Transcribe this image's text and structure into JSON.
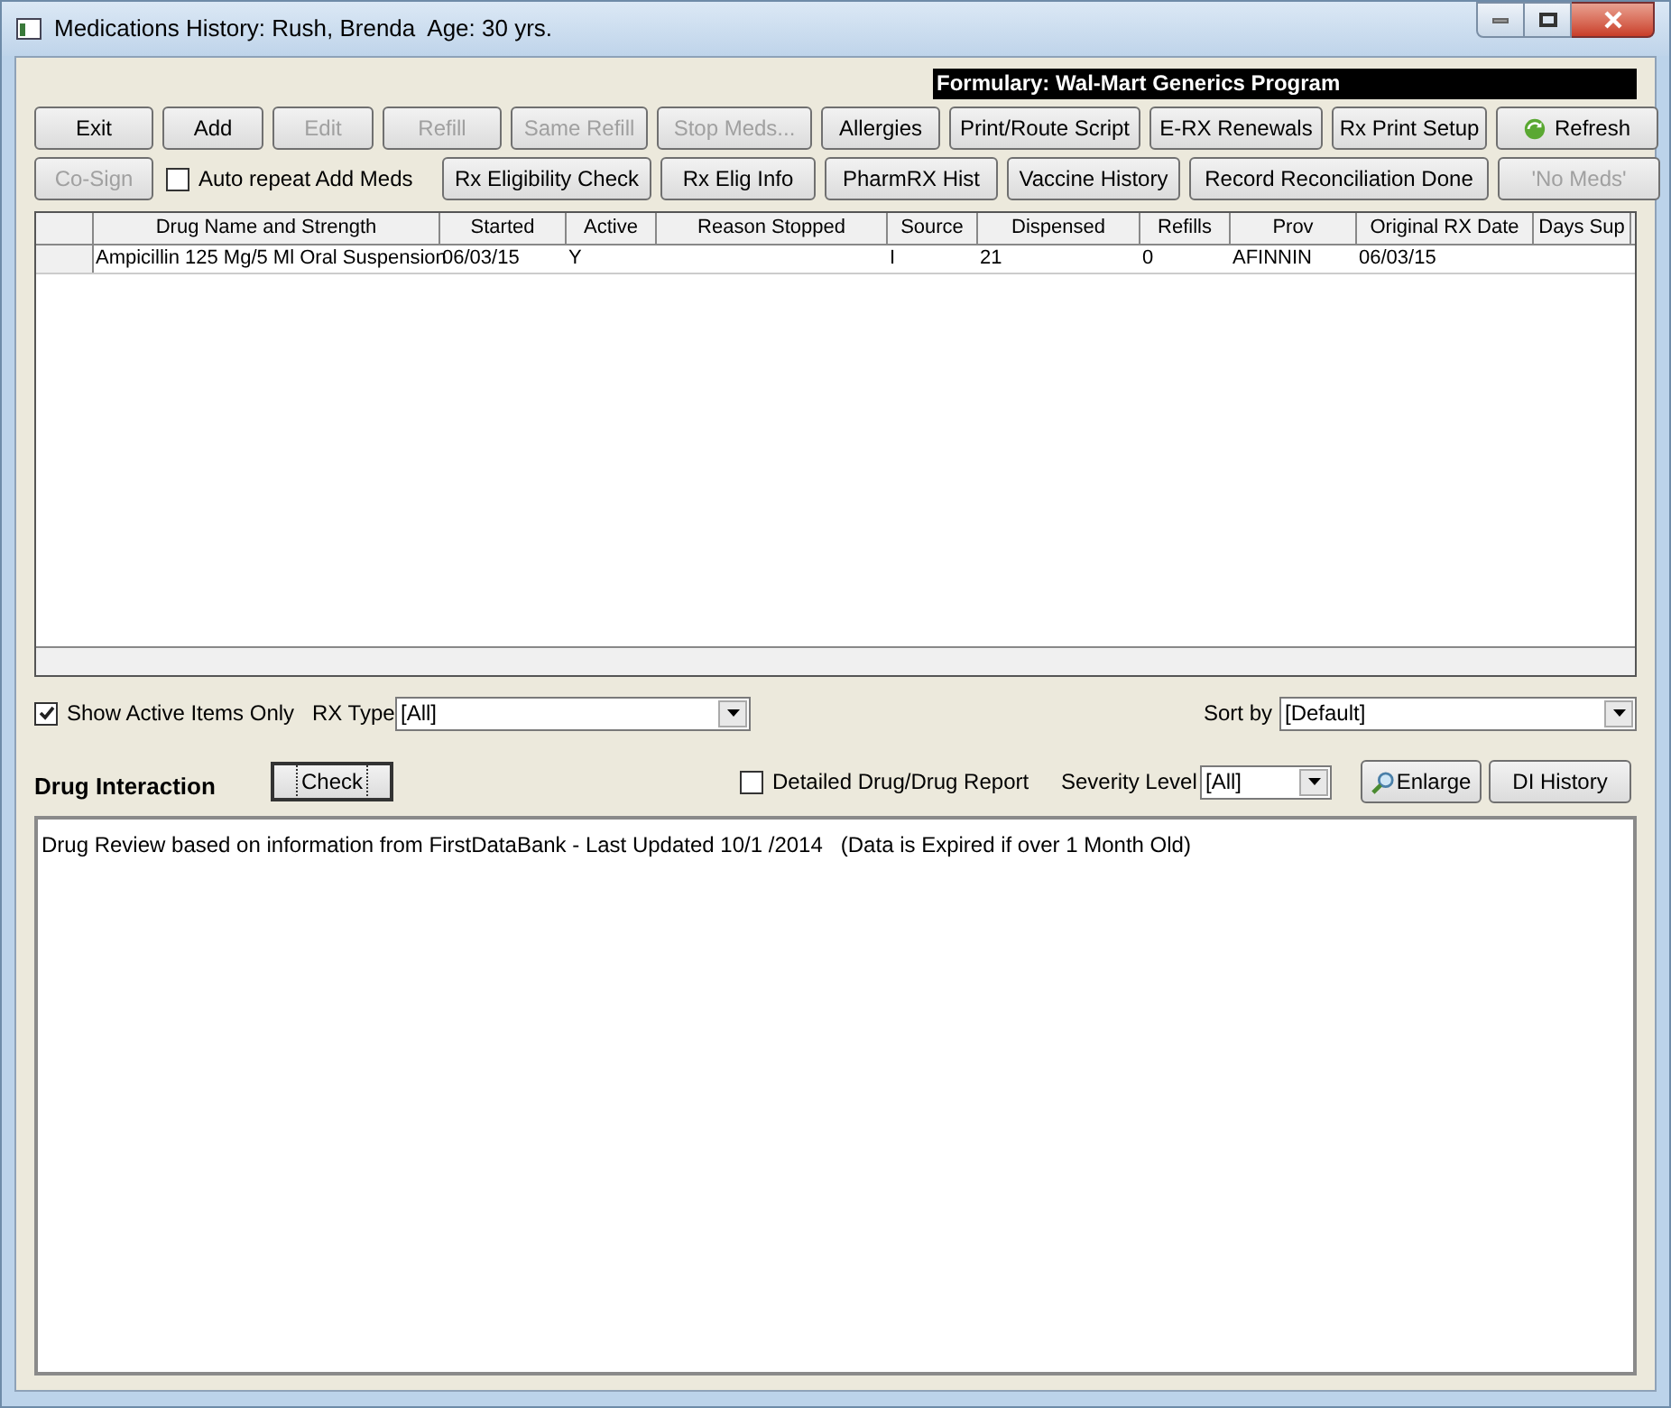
{
  "window": {
    "title": "Medications History: Rush, Brenda  Age: 30 yrs."
  },
  "formulary": "Formulary: Wal-Mart Generics Program",
  "toolbar_row_1": [
    {
      "label": "Exit",
      "disabled": false,
      "kind": "button"
    },
    {
      "label": "Add",
      "disabled": false,
      "kind": "button"
    },
    {
      "label": "Edit",
      "disabled": true,
      "kind": "button"
    },
    {
      "label": "Refill",
      "disabled": true,
      "kind": "button"
    },
    {
      "label": "Same Refill",
      "disabled": true,
      "kind": "button"
    },
    {
      "label": "Stop Meds...",
      "disabled": true,
      "kind": "button"
    },
    {
      "label": "Allergies",
      "disabled": false,
      "kind": "button"
    },
    {
      "label": "Print/Route Script",
      "disabled": false,
      "kind": "button"
    },
    {
      "label": "E-RX Renewals",
      "disabled": false,
      "kind": "button"
    },
    {
      "label": "Rx Print Setup",
      "disabled": false,
      "kind": "button"
    },
    {
      "label": "Refresh",
      "disabled": false,
      "kind": "refresh"
    }
  ],
  "toolbar_row_2": [
    {
      "label": "Co-Sign",
      "disabled": true,
      "kind": "button"
    },
    {
      "label": "Auto repeat Add Meds",
      "checked": false,
      "kind": "checkbox"
    },
    {
      "label": "Rx Eligibility Check",
      "disabled": false,
      "kind": "button"
    },
    {
      "label": "Rx Elig Info",
      "disabled": false,
      "kind": "button"
    },
    {
      "label": "PharmRX Hist",
      "disabled": false,
      "kind": "button"
    },
    {
      "label": "Vaccine History",
      "disabled": false,
      "kind": "button"
    },
    {
      "label": "Record Reconciliation Done",
      "disabled": false,
      "kind": "button"
    },
    {
      "label": "'No Meds'",
      "disabled": true,
      "kind": "button"
    }
  ],
  "table": {
    "columns": [
      "Drug Name and Strength",
      "Started",
      "Active",
      "Reason Stopped",
      "Source",
      "Dispensed",
      "Refills",
      "Prov",
      "Original RX Date",
      "Days Sup"
    ],
    "rows": [
      [
        "Ampicillin 125 Mg/5 Ml Oral Suspension",
        "06/03/15",
        "Y",
        "",
        "I",
        "21",
        "0",
        "AFINNIN",
        "06/03/15",
        ""
      ]
    ]
  },
  "filters": {
    "show_active": {
      "label": "Show Active Items Only",
      "checked": true
    },
    "rx_type": {
      "label": "RX Type",
      "value": "[All]"
    },
    "sort_by": {
      "label": "Sort by",
      "value": "[Default]"
    }
  },
  "drug_interaction": {
    "title": "Drug Interaction",
    "check_button": "Check",
    "detailed_report": {
      "label": "Detailed Drug/Drug Report",
      "checked": false
    },
    "severity": {
      "label": "Severity Level",
      "value": "[All]"
    },
    "enlarge_button": "Enlarge",
    "history_button": "DI History",
    "text": "Drug Review based on information from FirstDataBank - Last Updated 10/1 /2014   (Data is Expired if over 1 Month Old)"
  }
}
